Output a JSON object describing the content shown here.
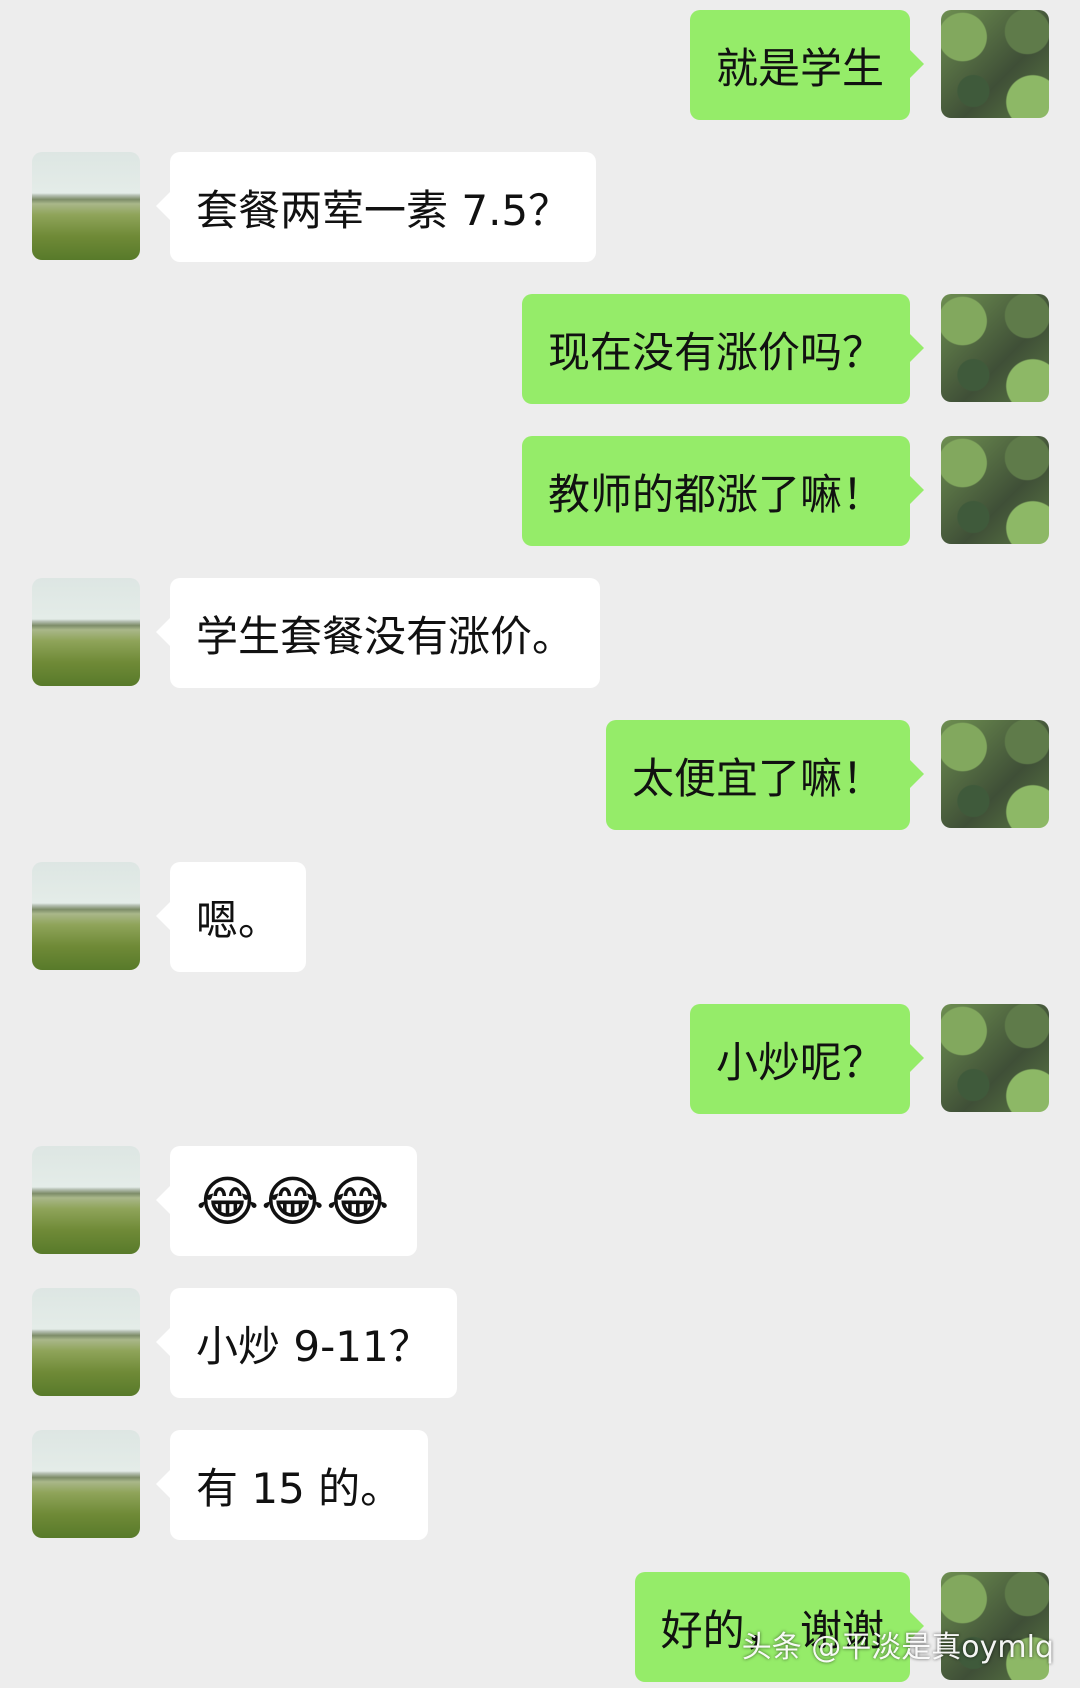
{
  "messages": [
    {
      "sender": "me",
      "text": "就是学生"
    },
    {
      "sender": "other",
      "text": "套餐两荤一素 7.5？"
    },
    {
      "sender": "me",
      "text": "现在没有涨价吗？"
    },
    {
      "sender": "me",
      "text": "教师的都涨了嘛！"
    },
    {
      "sender": "other",
      "text": "学生套餐没有涨价。"
    },
    {
      "sender": "me",
      "text": "太便宜了嘛！"
    },
    {
      "sender": "other",
      "text": "嗯。"
    },
    {
      "sender": "me",
      "text": "小炒呢？"
    },
    {
      "sender": "other",
      "text": "😂😂😂"
    },
    {
      "sender": "other",
      "text": "小炒 9-11？"
    },
    {
      "sender": "other",
      "text": "有 15 的。"
    },
    {
      "sender": "me",
      "text": "好的， 谢谢"
    }
  ],
  "watermark": "头条 @平淡是真oymlq",
  "colors": {
    "background": "#ededed",
    "outgoing_bubble": "#95ec69",
    "incoming_bubble": "#ffffff"
  }
}
